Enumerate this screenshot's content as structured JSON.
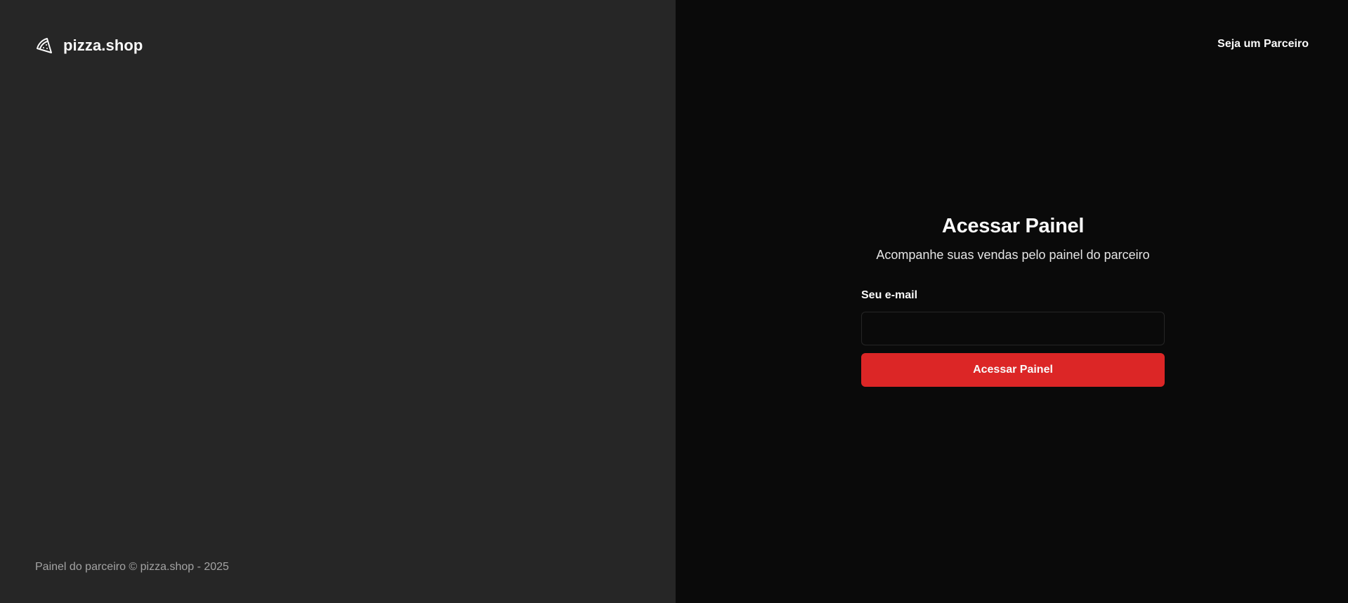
{
  "brand": {
    "name": "pizza.shop",
    "icon": "pizza-icon"
  },
  "footer": {
    "text": "Painel do parceiro © pizza.shop - 2025"
  },
  "header": {
    "partner_link_label": "Seja um Parceiro"
  },
  "login_form": {
    "title": "Acessar Painel",
    "subtitle": "Acompanhe suas vendas pelo painel do parceiro",
    "email_label": "Seu e-mail",
    "email_value": "",
    "submit_label": "Acessar Painel"
  },
  "colors": {
    "left_panel_bg": "#262626",
    "right_panel_bg": "#0a0a0a",
    "accent": "#dc2626"
  }
}
